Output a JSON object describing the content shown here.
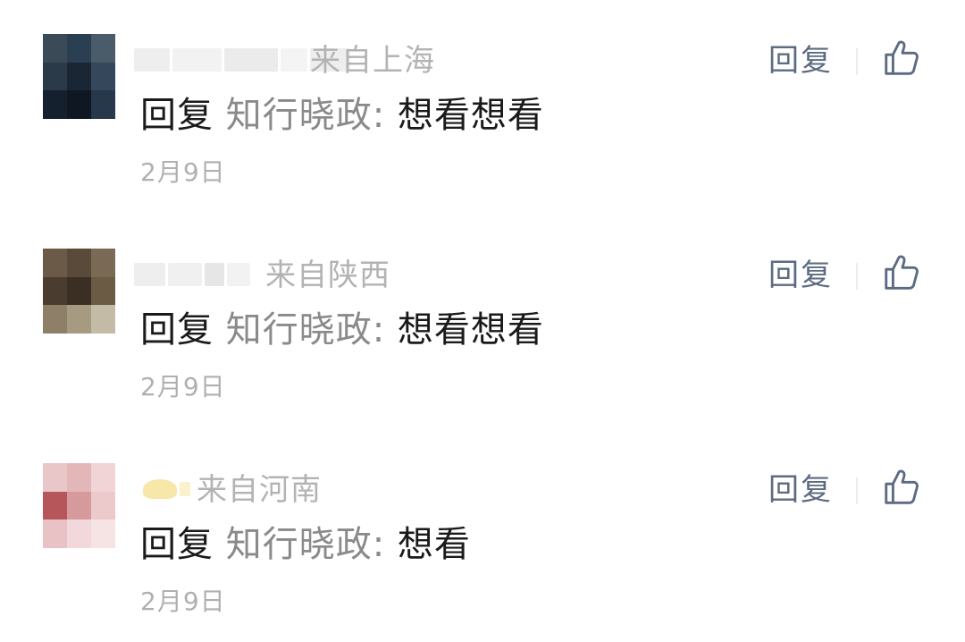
{
  "comments": [
    {
      "location": "来自上海",
      "reply_prefix": "回复",
      "reply_target": "知行晓政",
      "colon": ":",
      "text": "想看想看",
      "date": "2月9日",
      "reply_label": "回复",
      "like_icon": "thumbs-up-icon"
    },
    {
      "location": "来自陕西",
      "reply_prefix": "回复",
      "reply_target": "知行晓政",
      "colon": ":",
      "text": "想看想看",
      "date": "2月9日",
      "reply_label": "回复",
      "like_icon": "thumbs-up-icon"
    },
    {
      "location": "来自河南",
      "reply_prefix": "回复",
      "reply_target": "知行晓政",
      "colon": ":",
      "text": "想看",
      "date": "2月9日",
      "reply_label": "回复",
      "like_icon": "thumbs-up-icon"
    }
  ],
  "colors": {
    "action_text": "#5c6b82",
    "secondary_text": "#8a8a8a",
    "meta_text": "#b0b0b0",
    "primary_text": "#1a1a1a"
  }
}
